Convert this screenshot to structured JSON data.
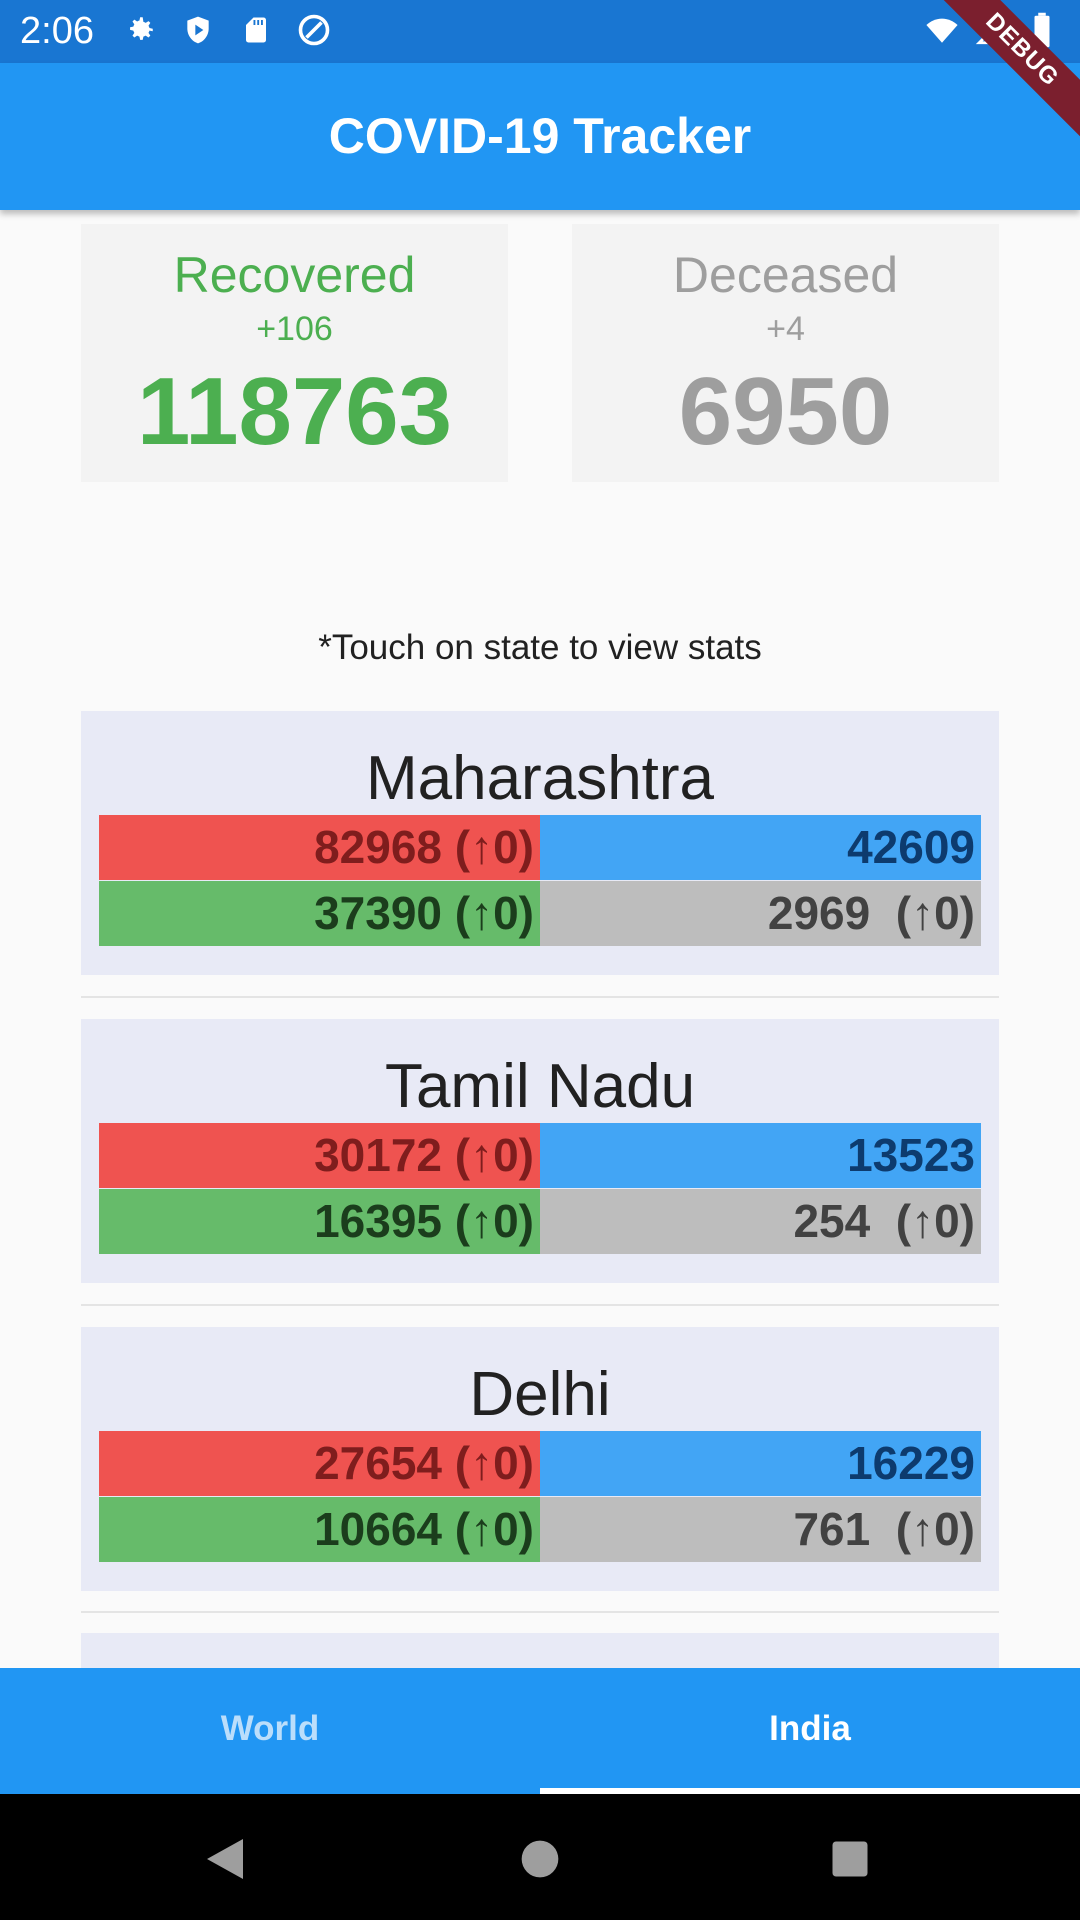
{
  "status_bar": {
    "time": "2:06",
    "left_icons": [
      "gear-icon",
      "shield-play-icon",
      "sd-card-icon",
      "at-sign-icon"
    ],
    "right_icons": [
      "wifi-icon",
      "signal-icon",
      "battery-icon"
    ]
  },
  "app_bar": {
    "title": "COVID-19 Tracker"
  },
  "debug_banner": "DEBUG",
  "summary": {
    "recovered": {
      "label": "Recovered",
      "delta": "+106",
      "total": "118763",
      "color": "#4CAF50"
    },
    "deceased": {
      "label": "Deceased",
      "delta": "+4",
      "total": "6950",
      "color": "#9E9E9E"
    }
  },
  "hint": "*Touch on state to view stats",
  "states": [
    {
      "name": "Maharashtra",
      "confirmed": "82968 (↑0)",
      "active": "42609",
      "recovered": "37390 (↑0)",
      "deceased": "2969  (↑0)"
    },
    {
      "name": "Tamil Nadu",
      "confirmed": "30172 (↑0)",
      "active": "13523",
      "recovered": "16395 (↑0)",
      "deceased": "254  (↑0)"
    },
    {
      "name": "Delhi",
      "confirmed": "27654 (↑0)",
      "active": "16229",
      "recovered": "10664 (↑0)",
      "deceased": "761  (↑0)"
    }
  ],
  "tabs": [
    {
      "label": "World",
      "selected": false
    },
    {
      "label": "India",
      "selected": true
    }
  ],
  "nav": [
    "back-icon",
    "home-icon",
    "recents-icon"
  ],
  "colors": {
    "primary": "#2196F3",
    "status_bar": "#1976D2",
    "confirmed": "#EF5350",
    "active": "#42A5F5",
    "recovered": "#66BB6A",
    "deceased": "#BDBDBD"
  }
}
